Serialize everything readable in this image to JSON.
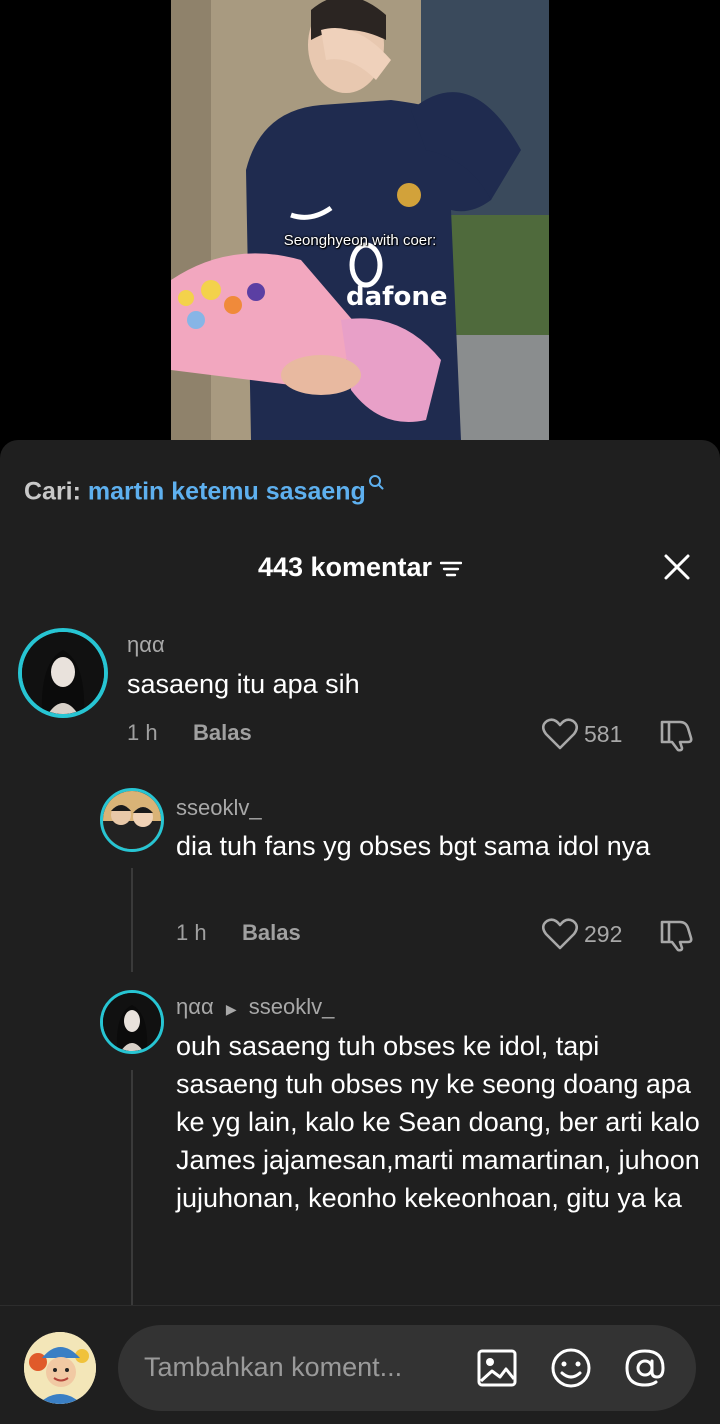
{
  "video": {
    "caption": "Seonghyeon with coer:"
  },
  "search": {
    "prefix": "Cari:",
    "query": "martin ketemu sasaeng"
  },
  "header": {
    "title": "443 komentar"
  },
  "comments": [
    {
      "username": "ηαα",
      "text": "sasaeng itu apa sih",
      "time": "1 h",
      "reply_label": "Balas",
      "likes": "581"
    },
    {
      "username": "sseoklv_",
      "text": "dia tuh fans yg obses bgt sama idol nya",
      "time": "1 h",
      "reply_label": "Balas",
      "likes": "292"
    },
    {
      "username": "ηαα",
      "reply_to": "sseoklv_",
      "text": "ouh sasaeng tuh obses ke idol, tapi sasaeng tuh obses ny ke seong doang apa ke yg lain, kalo ke Sean doang, ber arti kalo James jajamesan,marti mamartinan, juhoon jujuhonan, keonho kekeonhoan, gitu ya ka"
    }
  ],
  "composer": {
    "placeholder": "Tambahkan koment..."
  },
  "colors": {
    "accent_link": "#5eb0ef",
    "avatar_ring": "#27c5d3",
    "sheet_bg": "#1f1f1f"
  }
}
